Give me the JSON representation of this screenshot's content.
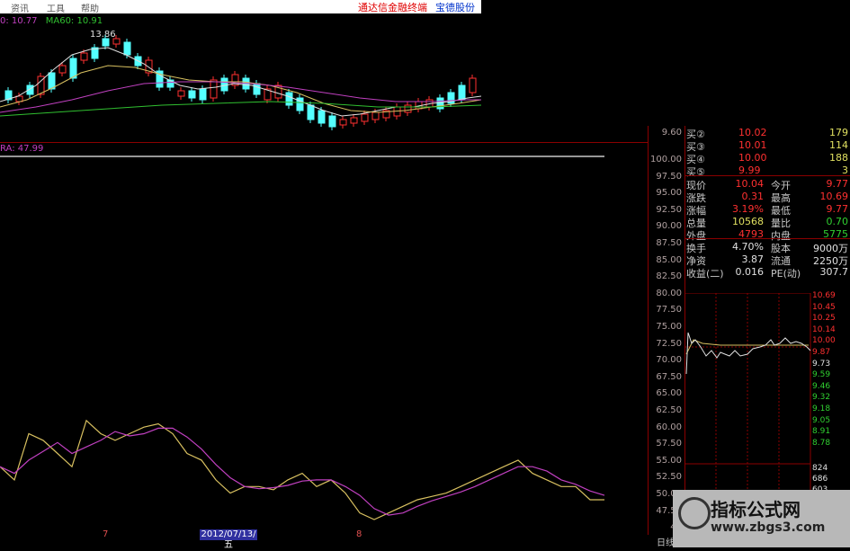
{
  "menubar": {
    "items": [
      "资讯",
      "工具",
      "帮助"
    ],
    "app_title": "通达信金融终端",
    "stock_name": "宝德股份"
  },
  "top_chart": {
    "ma_fragment": "0: 10.77",
    "ma60_label": "MA60: 10.91",
    "high_label": "13.86"
  },
  "indicator": {
    "label": "RA: 47.99"
  },
  "axis": {
    "top_price": "9.60",
    "ticks": [
      "100.00",
      "97.50",
      "95.00",
      "92.50",
      "90.00",
      "87.50",
      "85.00",
      "82.50",
      "80.00",
      "77.50",
      "75.00",
      "72.50",
      "70.00",
      "67.50",
      "65.00",
      "62.50",
      "60.00",
      "57.50",
      "55.00",
      "52.50",
      "50.00",
      "47.50",
      "45"
    ]
  },
  "quote": {
    "bids": [
      {
        "label": "买②",
        "price": "10.02",
        "vol": "179"
      },
      {
        "label": "买③",
        "price": "10.01",
        "vol": "114"
      },
      {
        "label": "买④",
        "price": "10.00",
        "vol": "188"
      },
      {
        "label": "买⑤",
        "price": "9.99",
        "vol": "3"
      }
    ],
    "rows": [
      {
        "l1": "现价",
        "v1": "10.04",
        "l2": "今开",
        "v2": "9.77"
      },
      {
        "l1": "涨跌",
        "v1": "0.31",
        "l2": "最高",
        "v2": "10.69"
      },
      {
        "l1": "涨幅",
        "v1": "3.19%",
        "l2": "最低",
        "v2": "9.77"
      },
      {
        "l1": "总量",
        "v1": "10568",
        "l2": "量比",
        "v2": "0.70"
      },
      {
        "l1": "外盘",
        "v1": "4793",
        "l2": "内盘",
        "v2": "5775"
      }
    ],
    "rows2": [
      {
        "l1": "换手",
        "v1": "4.70%",
        "l2": "股本",
        "v2": "9000万"
      },
      {
        "l1": "净资",
        "v1": "3.87",
        "l2": "流通",
        "v2": "2250万"
      },
      {
        "l1": "收益(二)",
        "v1": "0.016",
        "l2": "PE(动)",
        "v2": "307.7"
      }
    ]
  },
  "mini_chart": {
    "prices": [
      "10.69",
      "10.45",
      "10.25",
      "10.14",
      "10.00",
      "9.87",
      "9.73",
      "9.59",
      "9.46",
      "9.32",
      "9.18",
      "9.05",
      "8.91",
      "8.78"
    ],
    "volumes": [
      "824",
      "686",
      "603"
    ]
  },
  "date_bar": {
    "selected_date": "2012/07/13/五",
    "marker7": "7",
    "marker8": "8"
  },
  "bottom_label": "日线",
  "watermark": {
    "title": "指标公式网",
    "url": "www.zbgs3.com"
  },
  "colors": {
    "up": "#ff3030",
    "down": "#54ffff",
    "ma_white": "#e0e0e0",
    "ma_yellow": "#d8c060",
    "ma_purple": "#c040c0",
    "ma_green": "#30c030",
    "accent_red": "#8b0000"
  },
  "chart_data": {
    "type": "line",
    "series": [
      {
        "name": "RA",
        "values": [
          53,
          51,
          58,
          57,
          55,
          53,
          60,
          58,
          57,
          58,
          59,
          59.5,
          58,
          55,
          54,
          51,
          49,
          50,
          50,
          49.5,
          51,
          52,
          50,
          51,
          49,
          46,
          45,
          46,
          47,
          48,
          48.5,
          49,
          50,
          51,
          52,
          53,
          54,
          52,
          51,
          50,
          50,
          48,
          47.99
        ]
      }
    ],
    "ylim": [
      45,
      100
    ]
  }
}
